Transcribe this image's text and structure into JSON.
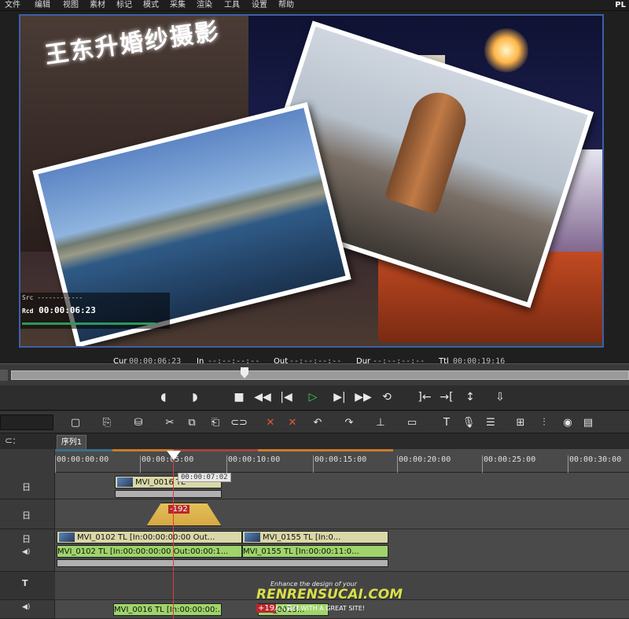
{
  "menu": [
    "文件",
    "编辑",
    "视图",
    "素材",
    "标记",
    "模式",
    "采集",
    "渲染",
    "工具",
    "设置",
    "帮助"
  ],
  "app_badge": "PL",
  "video": {
    "sign_text": "王东升婚纱摄影",
    "overlay": {
      "src_label": "Src ------------",
      "rcd_label": "Rcd",
      "rcd_timecode": "00:00:06:23"
    }
  },
  "info": {
    "cur_label": "Cur",
    "cur_value": "00:00:06:23",
    "in_label": "In",
    "in_value": "--:--:--:--",
    "out_label": "Out",
    "out_value": "--:--:--:--",
    "dur_label": "Dur",
    "dur_value": "--:--:--:--",
    "ttl_label": "Ttl",
    "ttl_value": "00:00:19:16"
  },
  "sequence": {
    "tab_label": "序列1"
  },
  "ruler": {
    "ticks": [
      "00:00:00:00",
      "00:00:05:00",
      "00:00:10:00",
      "00:00:15:00",
      "00:00:20:00",
      "00:00:25:00",
      "00:00:30:00"
    ]
  },
  "playhead_tooltip": "00:00:07:02",
  "tracks": {
    "t1_icon": "日",
    "t2_icon": "日",
    "t3_icon": "日",
    "t3a_icon": "◀)",
    "t4_icon": "T",
    "t5_icon": "◀)",
    "clip_v1": "MVI_0016  TL",
    "clip_v2_badge": "-192",
    "clip_v3a": "MVI_0102  TL [In:00:00:00:00 Out...",
    "clip_v3b": "MVI_0155  TL [In:0...",
    "clip_a3a": "MVI_0102  TL [In:00:00:00:00 Out:00:00:1...",
    "clip_a3b": "MVI_0155  TL [In:00:00:11:0...",
    "clip_a5a": "MVI_0016  TL [In:00:00:00:...",
    "clip_a5b": "MVI_0013...",
    "clip_a5_badge": "+19"
  },
  "watermark": {
    "line1": "Enhance the design of your",
    "line2": "RENRENSUCAI.COM",
    "line3": "人人素材 WITH A GREAT SITE!"
  }
}
